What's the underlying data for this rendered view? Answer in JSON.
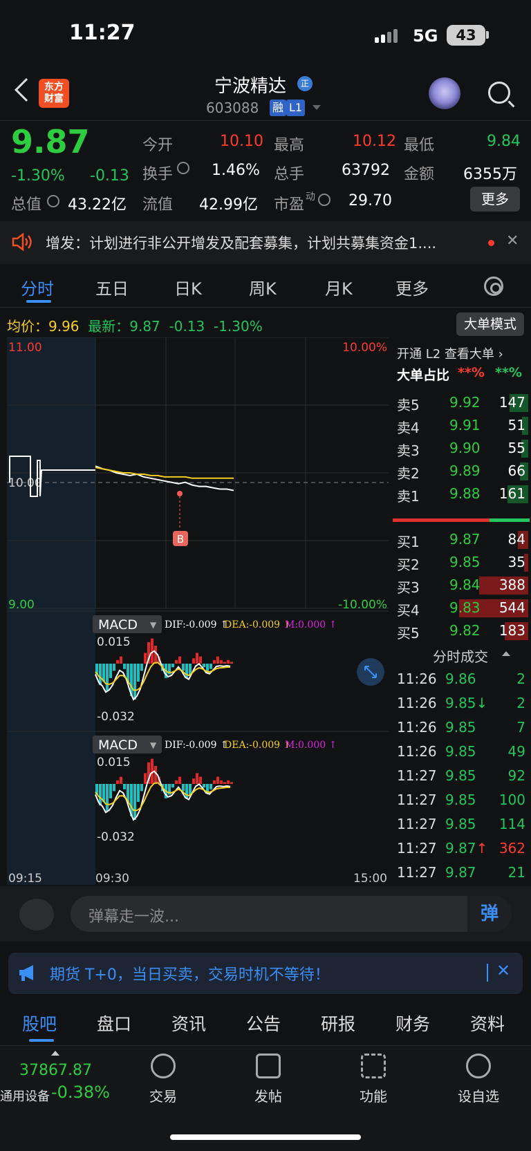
{
  "status": {
    "time": "11:27",
    "network": "5G",
    "battery": "43"
  },
  "header": {
    "title": "宁波精达",
    "code": "603088",
    "tag_rong": "融",
    "tag_level": "L1",
    "logo_line1": "东方",
    "logo_line2": "财富",
    "badge": "正"
  },
  "quote": {
    "price": "9.87",
    "change_pct": "-1.30%",
    "change": "-0.13",
    "open_label": "今开",
    "open": "10.10",
    "high_label": "最高",
    "high": "10.12",
    "low_label": "最低",
    "low": "9.84",
    "turnover_label": "换手",
    "turnover": "1.46%",
    "volume_label": "总手",
    "volume": "63792",
    "amount_label": "金额",
    "amount": "6355万",
    "mktcap_label": "总值",
    "mktcap": "43.22亿",
    "float_label": "流值",
    "float": "42.99亿",
    "pe_label": "市盈",
    "pe_sup": "动",
    "pe": "29.70",
    "more_label": "更多"
  },
  "notice": {
    "text": "增发：计划进行非公开增发及配套募集，计划共募集资金1...."
  },
  "tabs": [
    "分时",
    "五日",
    "日K",
    "周K",
    "月K",
    "更多"
  ],
  "infoline": {
    "avg_label": "均价：",
    "avg": "9.96",
    "latest_label": "最新：",
    "latest": "9.87",
    "chg": "-0.13",
    "pct": "-1.30%",
    "mode": "大单模式"
  },
  "chart_data": {
    "type": "line",
    "title": "",
    "price_axis": {
      "top": "11.00",
      "mid": "10.00",
      "bottom": "9.00",
      "pct_top": "10.00%",
      "pct_bottom": "-10.00%"
    },
    "ylim": [
      9.0,
      11.0
    ],
    "x_labels": [
      "09:15",
      "09:30",
      "15:00"
    ],
    "series": [
      {
        "name": "最新",
        "values": [
          10.05,
          10.03,
          10.02,
          10.0,
          9.99,
          9.98,
          9.99,
          9.97,
          9.96,
          9.95,
          9.94,
          9.93,
          9.92,
          9.93,
          9.91,
          9.9,
          9.9,
          9.89,
          9.88,
          9.88,
          9.87
        ]
      },
      {
        "name": "均价",
        "values": [
          10.04,
          10.03,
          10.02,
          10.01,
          10.0,
          10.0,
          9.99,
          9.99,
          9.98,
          9.98,
          9.97,
          9.97,
          9.97,
          9.97,
          9.96,
          9.96,
          9.96,
          9.96,
          9.96,
          9.96,
          9.96
        ]
      }
    ],
    "macd_label": "MACD",
    "dif": "DIF:-0.009 ↑",
    "dea": "DEA:-0.009 ↑",
    "m": "M:0.000 ↑",
    "macd_top": "0.015",
    "macd_bottom": "-0.032",
    "macd_hist": [
      -0.006,
      -0.012,
      -0.01,
      -0.015,
      -0.008,
      -0.004,
      0.002,
      0.004,
      -0.003,
      -0.01,
      -0.018,
      -0.02,
      -0.01,
      -0.004,
      0.006,
      0.012,
      0.014,
      0.01,
      0.004,
      -0.004,
      -0.008,
      -0.006,
      -0.002,
      0.002,
      0.004,
      -0.004,
      -0.008,
      -0.006,
      0.003,
      0.006,
      0.004,
      -0.002,
      -0.005,
      -0.003,
      0.002,
      0.004,
      0.002,
      0.001,
      0.002,
      0.001
    ]
  },
  "l2": {
    "title": "开通 L2 查看大单",
    "ratio_label": "大单占比",
    "ratio_red": "**%",
    "ratio_green": "**%"
  },
  "orderbook": {
    "sell": [
      {
        "l": "卖5",
        "p": "9.92",
        "v": "147"
      },
      {
        "l": "卖4",
        "p": "9.91",
        "v": "51"
      },
      {
        "l": "卖3",
        "p": "9.90",
        "v": "55"
      },
      {
        "l": "卖2",
        "p": "9.89",
        "v": "66"
      },
      {
        "l": "卖1",
        "p": "9.88",
        "v": "161"
      }
    ],
    "buy": [
      {
        "l": "买1",
        "p": "9.87",
        "v": "84"
      },
      {
        "l": "买2",
        "p": "9.85",
        "v": "35"
      },
      {
        "l": "买3",
        "p": "9.84",
        "v": "388"
      },
      {
        "l": "买4",
        "p": "9.83",
        "v": "544"
      },
      {
        "l": "买5",
        "p": "9.82",
        "v": "183"
      }
    ]
  },
  "trades": {
    "title": "分时成交",
    "rows": [
      {
        "t": "11:26",
        "p": "9.86",
        "v": "2"
      },
      {
        "t": "11:26",
        "p": "9.85↓",
        "v": "2"
      },
      {
        "t": "11:26",
        "p": "9.85",
        "v": "7"
      },
      {
        "t": "11:26",
        "p": "9.85",
        "v": "49"
      },
      {
        "t": "11:27",
        "p": "9.85",
        "v": "92"
      },
      {
        "t": "11:27",
        "p": "9.85",
        "v": "100"
      },
      {
        "t": "11:27",
        "p": "9.85",
        "v": "114"
      },
      {
        "t": "11:27",
        "p": "9.87↑",
        "v": "362"
      },
      {
        "t": "11:27",
        "p": "9.87",
        "v": "21"
      }
    ]
  },
  "danmu": {
    "placeholder": "弹幕走一波...",
    "btn": "弹"
  },
  "ad": {
    "text": "期货 T+0，当日买卖，交易时机不等待！"
  },
  "bottom_tabs": [
    "股吧",
    "盘口",
    "资讯",
    "公告",
    "研报",
    "财务",
    "资料"
  ],
  "dock": {
    "index_value": "37867.87",
    "index_name": "通用设备",
    "index_pct": "-0.38%",
    "items": [
      "交易",
      "发帖",
      "功能",
      "设自选"
    ]
  },
  "colors": {
    "up": "#ff3b30",
    "down": "#22c55e",
    "accent": "#3a8ef5",
    "avg": "#f5d020"
  }
}
